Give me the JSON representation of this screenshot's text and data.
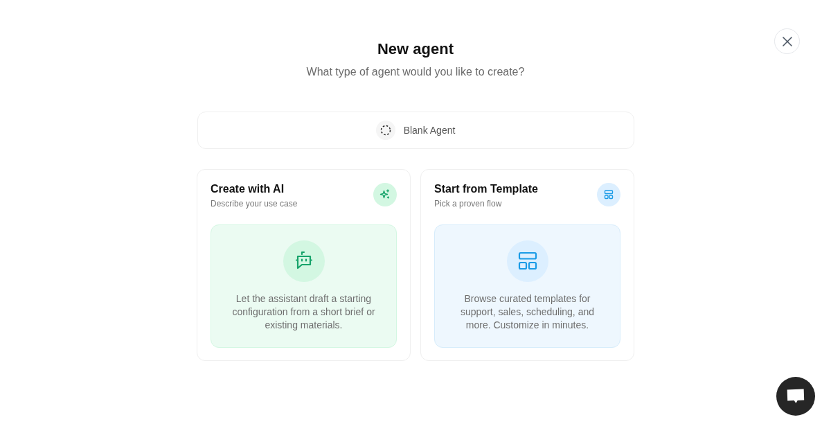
{
  "dialog": {
    "title": "New agent",
    "subtitle": "What type of agent would you like to create?"
  },
  "blank_option": {
    "label": "Blank Agent"
  },
  "options": [
    {
      "kind": "ai",
      "title": "Create with AI",
      "subtitle": "Describe your use case",
      "description": "Let the assistant draft a starting configuration from a short brief or existing materials."
    },
    {
      "kind": "template",
      "title": "Start from Template",
      "subtitle": "Pick a proven flow",
      "description": "Browse curated templates for support, sales, scheduling, and more. Customize in minutes."
    }
  ]
}
